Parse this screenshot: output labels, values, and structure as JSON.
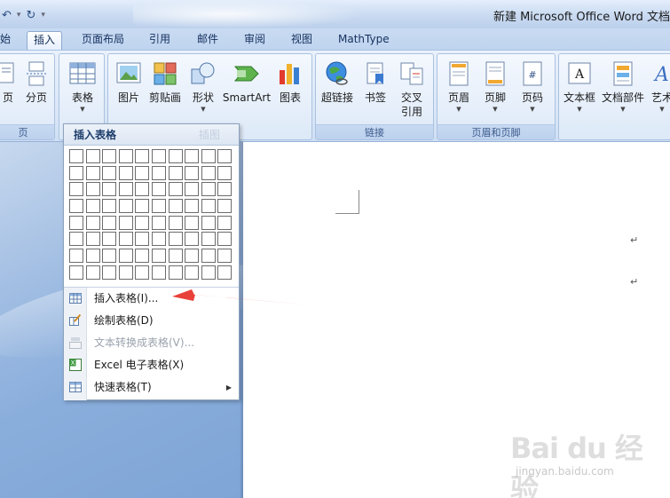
{
  "window": {
    "title": "新建 Microsoft Office Word 文档"
  },
  "qat": {
    "undo_icon": "undo-icon",
    "redo_icon": "redo-icon",
    "customize_icon": "chevron-down-icon"
  },
  "tabs": [
    {
      "label": "始"
    },
    {
      "label": "插入"
    },
    {
      "label": "页面布局"
    },
    {
      "label": "引用"
    },
    {
      "label": "邮件"
    },
    {
      "label": "审阅"
    },
    {
      "label": "视图"
    },
    {
      "label": "MathType"
    }
  ],
  "ribbon": {
    "pages_group": {
      "label": "页",
      "buttons": [
        {
          "label": "页"
        },
        {
          "label": "分页"
        }
      ]
    },
    "tables_group": {
      "buttons": [
        {
          "label": "表格"
        }
      ]
    },
    "illustrations_group": {
      "label": "插图",
      "buttons": [
        {
          "label": "图片"
        },
        {
          "label": "剪贴画"
        },
        {
          "label": "形状"
        },
        {
          "label": "SmartArt"
        },
        {
          "label": "图表"
        }
      ]
    },
    "links_group": {
      "label": "链接",
      "buttons": [
        {
          "label": "超链接"
        },
        {
          "label": "书签"
        },
        {
          "label": "交叉",
          "label2": "引用"
        }
      ]
    },
    "header_footer_group": {
      "label": "页眉和页脚",
      "buttons": [
        {
          "label": "页眉"
        },
        {
          "label": "页脚"
        },
        {
          "label": "页码"
        }
      ]
    },
    "text_group": {
      "buttons": [
        {
          "label": "文本框"
        },
        {
          "label": "文档部件"
        },
        {
          "label": "艺术"
        }
      ]
    }
  },
  "table_dropdown": {
    "header": "插入表格",
    "header_ghost": "插图",
    "grid": {
      "rows": 8,
      "cols": 10
    },
    "menu": [
      {
        "label": "插入表格(I)...",
        "icon": "insert-table-icon",
        "enabled": true
      },
      {
        "label": "绘制表格(D)",
        "icon": "draw-table-icon",
        "enabled": true
      },
      {
        "label": "文本转换成表格(V)...",
        "icon": "text-to-table-icon",
        "enabled": false
      },
      {
        "label": "Excel 电子表格(X)",
        "icon": "excel-icon",
        "enabled": true
      },
      {
        "label": "快速表格(T)",
        "icon": "quick-table-icon",
        "enabled": true,
        "submenu": true
      }
    ]
  },
  "document": {
    "paragraph_mark": "↵"
  },
  "watermark": {
    "logo": "Bai du 经验",
    "url": "jingyan.baidu.com"
  },
  "colors": {
    "annotation_arrow": "#e8413a",
    "ribbon_accent": "#15305e"
  }
}
